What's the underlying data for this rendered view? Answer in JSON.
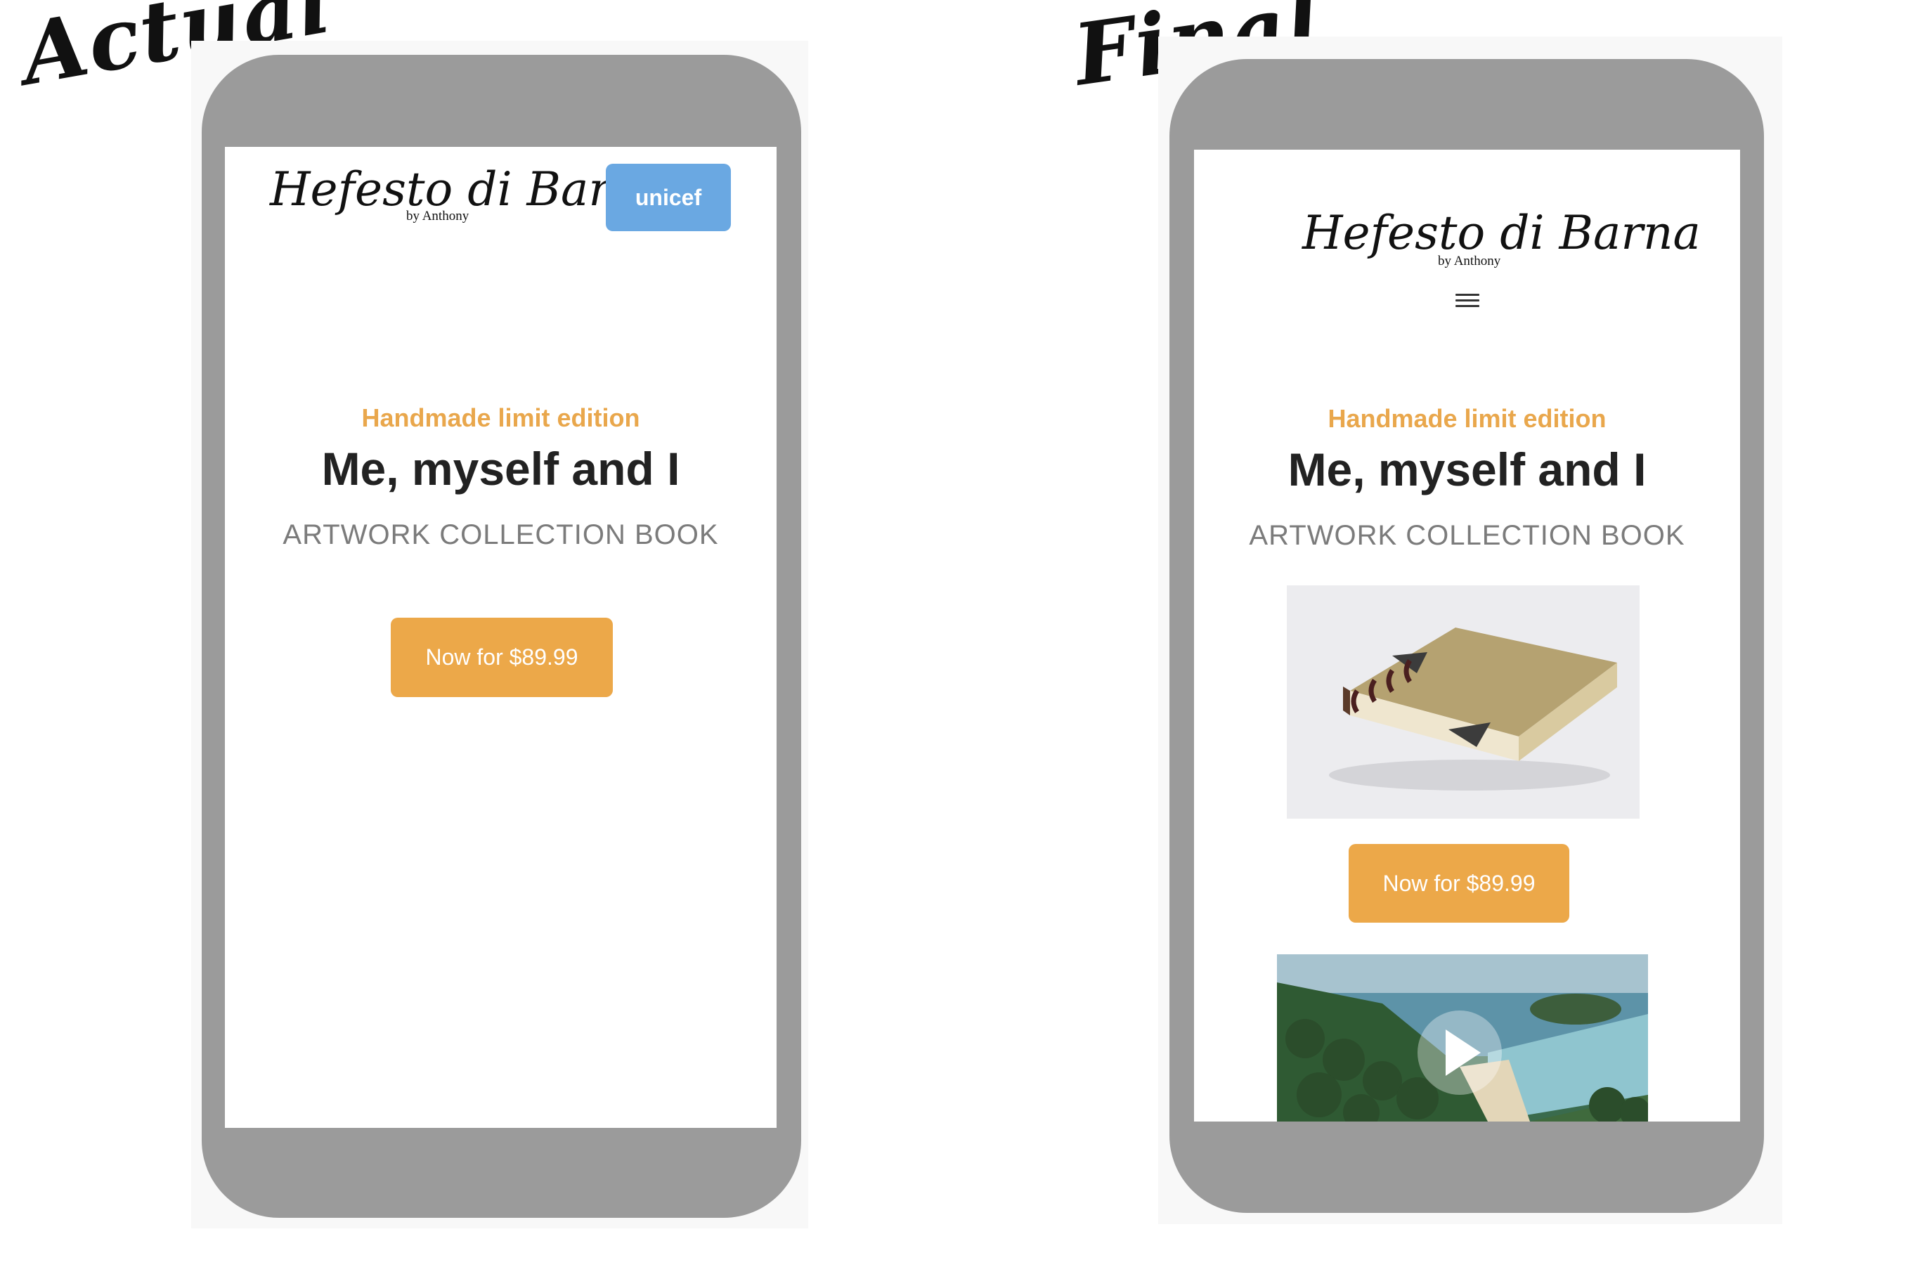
{
  "labels": {
    "actual": "Actual",
    "final": "Final"
  },
  "actual_screen": {
    "logo_text": "Hefesto di Barna",
    "logo_subtitle": "by Anthony",
    "badge_text": "unicef",
    "eyebrow": "Handmade limit edition",
    "title": "Me, myself and I",
    "subtitle": "ARTWORK COLLECTION BOOK",
    "cta_label": "Now for $89.99"
  },
  "final_screen": {
    "logo_text": "Hefesto di Barna",
    "logo_subtitle": "by Anthony",
    "menu_icon": "hamburger-menu-icon",
    "eyebrow": "Handmade limit edition",
    "title": "Me, myself and I",
    "subtitle": "ARTWORK COLLECTION BOOK",
    "image": "book-photo",
    "cta_label": "Now for $89.99",
    "video_icon": "play-icon"
  },
  "colors": {
    "accent_orange": "#eca849",
    "eyebrow_orange": "#e9a74c",
    "unicef_blue": "#6aa8e2",
    "phone_gray": "#9b9b9b",
    "title_dark": "#222222",
    "subtitle_gray": "#7b7b7b"
  }
}
